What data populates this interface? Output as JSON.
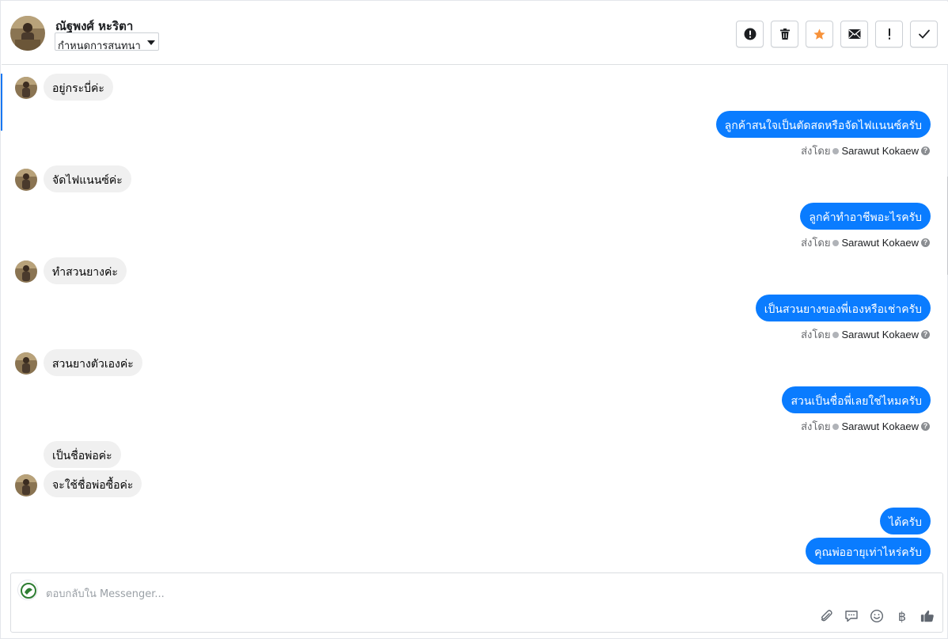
{
  "header": {
    "contact_name": "ณัฐพงศ์ หะริตา",
    "conversation_select": "กำหนดการสนทนา",
    "actions": [
      {
        "name": "spam-button",
        "icon": "alert-circle-icon"
      },
      {
        "name": "delete-button",
        "icon": "trash-icon"
      },
      {
        "name": "star-button",
        "icon": "star-icon"
      },
      {
        "name": "mark-unread-button",
        "icon": "envelope-icon"
      },
      {
        "name": "follow-up-button",
        "icon": "exclamation-icon"
      },
      {
        "name": "mark-done-button",
        "icon": "check-icon"
      }
    ]
  },
  "messages": {
    "m1": "อยู่กระบี่ค่ะ",
    "m2": "ลูกค้าสนใจเป็นตัดสดหรือจัดไฟแนนซ์ครับ",
    "m3": "จัดไฟแนนซ์ค่ะ",
    "m4": "ลูกค้าทำอาชีพอะไรครับ",
    "m5": "ทำสวนยางค่ะ",
    "m6": "เป็นสวนยางของพี่เองหรือเช่าครับ",
    "m7": "สวนยางตัวเองค่ะ",
    "m8": "สวนเป็นชื่อพี่เลยใช่ไหมครับ",
    "m9": "เป็นชื่อพ่อค่ะ",
    "m10": "จะใช้ชื่อพ่อซื้อค่ะ",
    "m11": "ได้ครับ",
    "m12": "คุณพ่ออายุเท่าไหร่ครับ"
  },
  "sent_by": {
    "label": "ส่งโดย",
    "agent": "Sarawut Kokaew"
  },
  "composer": {
    "placeholder": "ตอบกลับใน Messenger...",
    "currency_symbol": "฿",
    "tools": [
      "paperclip-icon",
      "saved-reply-icon",
      "emoji-icon",
      "baht-icon",
      "thumbs-up-icon"
    ]
  },
  "colors": {
    "outgoing_bubble": "#0a7cff",
    "incoming_bubble": "#f0f0f0",
    "star": "#f7923a",
    "accent": "#1877f2"
  }
}
